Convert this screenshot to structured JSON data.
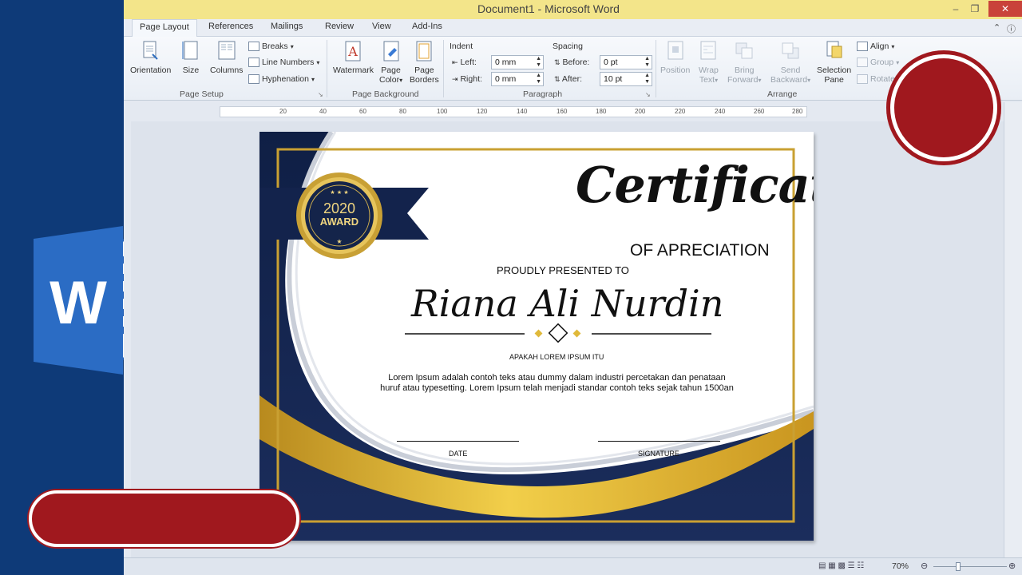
{
  "window": {
    "title": "Document1  -  Microsoft Word"
  },
  "tabs": [
    {
      "label": "Page Layout",
      "active": true
    },
    {
      "label": "References"
    },
    {
      "label": "Mailings"
    },
    {
      "label": "Review"
    },
    {
      "label": "View"
    },
    {
      "label": "Add-Ins"
    }
  ],
  "ribbon": {
    "page_setup": {
      "orientation": "Orientation",
      "size": "Size",
      "columns": "Columns",
      "breaks": "Breaks",
      "line_numbers": "Line Numbers",
      "hyphenation": "Hyphenation",
      "label": "Page Setup"
    },
    "page_background": {
      "watermark": "Watermark",
      "page_color_1": "Page",
      "page_color_2": "Color",
      "page_borders_1": "Page",
      "page_borders_2": "Borders",
      "label": "Page Background"
    },
    "paragraph": {
      "indent_label": "Indent",
      "left_label": "Left:",
      "left_value": "0 mm",
      "right_label": "Right:",
      "right_value": "0 mm",
      "spacing_label": "Spacing",
      "before_label": "Before:",
      "before_value": "0 pt",
      "after_label": "After:",
      "after_value": "10 pt",
      "label": "Paragraph"
    },
    "arrange": {
      "position": "Position",
      "wrap_1": "Wrap",
      "wrap_2": "Text",
      "bring_1": "Bring",
      "bring_2": "Forward",
      "send_1": "Send",
      "send_2": "Backward",
      "selection_1": "Selection",
      "selection_2": "Pane",
      "align": "Align",
      "group": "Group",
      "rotate": "Rotate",
      "label": "Arrange"
    }
  },
  "ruler": {
    "ticks": [
      "20",
      "40",
      "60",
      "80",
      "100",
      "120",
      "140",
      "160",
      "180",
      "200",
      "220",
      "240",
      "260",
      "280"
    ]
  },
  "certificate": {
    "title": "Certificate",
    "subtitle": "OF APRECIATION",
    "presented": "PROUDLY PRESENTED TO",
    "recipient": "Riana Ali Nurdin",
    "caption": "APAKAH LOREM IPSUM ITU",
    "body": "Lorem Ipsum adalah contoh teks atau dummy dalam industri percetakan dan penataan huruf atau typesetting. Lorem Ipsum telah menjadi standar contoh teks sejak tahun 1500an",
    "date_label": "DATE",
    "signature_label": "SIGNATURE",
    "badge_year": "2020",
    "badge_text": "AWARD"
  },
  "status": {
    "zoom": "70%"
  },
  "colors": {
    "navy": "#0f1f45",
    "gold": "#d9ad2c",
    "word_blue": "#0e3a78",
    "accent_red": "#a0181e"
  }
}
